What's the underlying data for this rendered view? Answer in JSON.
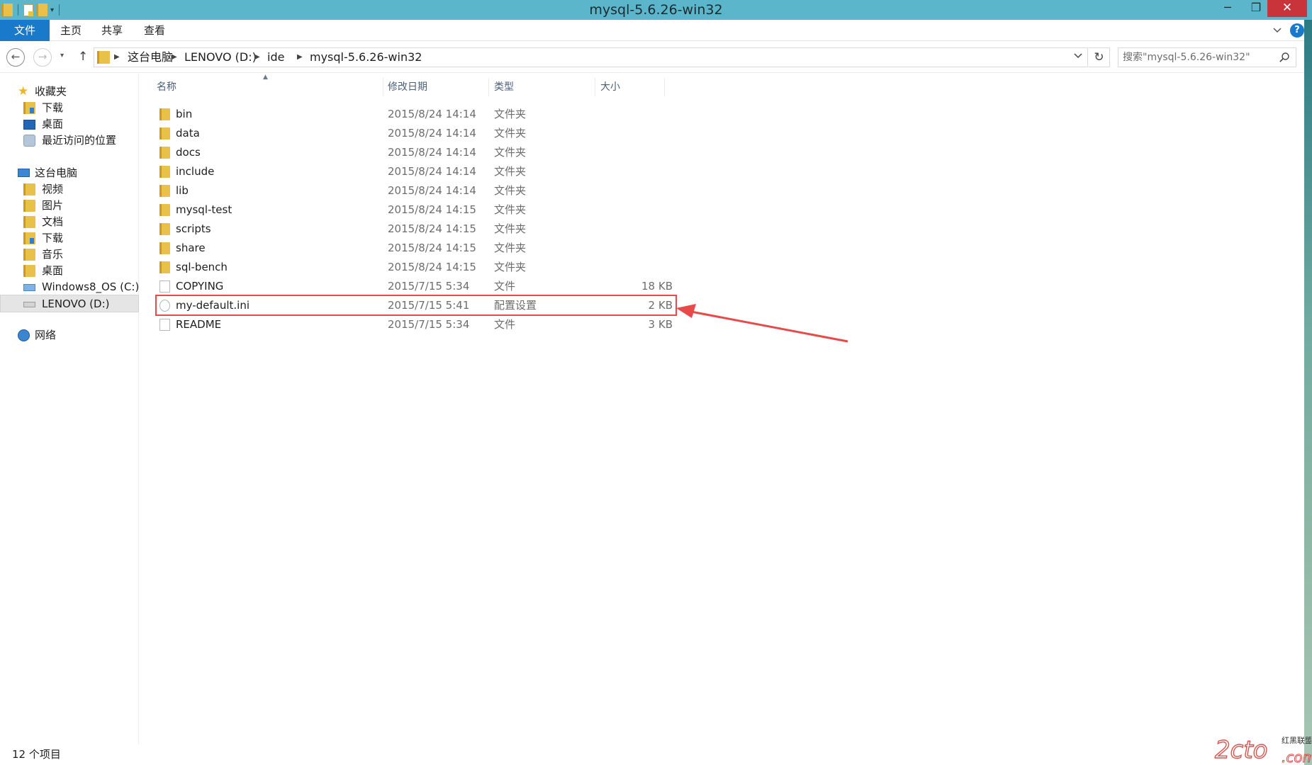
{
  "window": {
    "title": "mysql-5.6.26-win32",
    "minimize_glyph": "─",
    "maximize_glyph": "❐",
    "close_glyph": "✕"
  },
  "ribbon": {
    "tabs": [
      {
        "label": "文件",
        "active": true
      },
      {
        "label": "主页"
      },
      {
        "label": "共享"
      },
      {
        "label": "查看"
      }
    ],
    "help_glyph": "?"
  },
  "address": {
    "back_glyph": "←",
    "forward_glyph": "→",
    "up_glyph": "↑",
    "refresh_glyph": "↻",
    "breadcrumbs": [
      "这台电脑",
      "LENOVO (D:)",
      "ide",
      "mysql-5.6.26-win32"
    ]
  },
  "search": {
    "placeholder": "搜索\"mysql-5.6.26-win32\""
  },
  "sidebar": {
    "items": [
      {
        "label": "收藏夹",
        "icon": "star-icon",
        "indent": 0
      },
      {
        "label": "下载",
        "icon": "downloads-folder-icon",
        "indent": 1
      },
      {
        "label": "桌面",
        "icon": "desktop-icon",
        "indent": 1
      },
      {
        "label": "最近访问的位置",
        "icon": "recent-places-icon",
        "indent": 1
      },
      {
        "label": "这台电脑",
        "icon": "computer-icon",
        "indent": 0
      },
      {
        "label": "视频",
        "icon": "videos-folder-icon",
        "indent": 1
      },
      {
        "label": "图片",
        "icon": "pictures-folder-icon",
        "indent": 1
      },
      {
        "label": "文档",
        "icon": "documents-folder-icon",
        "indent": 1
      },
      {
        "label": "下载",
        "icon": "downloads-folder-icon",
        "indent": 1
      },
      {
        "label": "音乐",
        "icon": "music-folder-icon",
        "indent": 1
      },
      {
        "label": "桌面",
        "icon": "desktop-folder-icon",
        "indent": 1
      },
      {
        "label": "Windows8_OS (C:)",
        "icon": "drive-c-icon",
        "indent": 1
      },
      {
        "label": "LENOVO (D:)",
        "icon": "drive-d-icon",
        "indent": 1,
        "selected": true
      },
      {
        "label": "网络",
        "icon": "network-icon",
        "indent": 0
      }
    ]
  },
  "columns": {
    "name": "名称",
    "date": "修改日期",
    "type": "类型",
    "size": "大小"
  },
  "files": [
    {
      "name": "bin",
      "date": "2015/8/24 14:14",
      "type": "文件夹",
      "size": "",
      "kind": "folder"
    },
    {
      "name": "data",
      "date": "2015/8/24 14:14",
      "type": "文件夹",
      "size": "",
      "kind": "folder"
    },
    {
      "name": "docs",
      "date": "2015/8/24 14:14",
      "type": "文件夹",
      "size": "",
      "kind": "folder"
    },
    {
      "name": "include",
      "date": "2015/8/24 14:14",
      "type": "文件夹",
      "size": "",
      "kind": "folder"
    },
    {
      "name": "lib",
      "date": "2015/8/24 14:14",
      "type": "文件夹",
      "size": "",
      "kind": "folder"
    },
    {
      "name": "mysql-test",
      "date": "2015/8/24 14:15",
      "type": "文件夹",
      "size": "",
      "kind": "folder"
    },
    {
      "name": "scripts",
      "date": "2015/8/24 14:15",
      "type": "文件夹",
      "size": "",
      "kind": "folder"
    },
    {
      "name": "share",
      "date": "2015/8/24 14:15",
      "type": "文件夹",
      "size": "",
      "kind": "folder"
    },
    {
      "name": "sql-bench",
      "date": "2015/8/24 14:15",
      "type": "文件夹",
      "size": "",
      "kind": "folder"
    },
    {
      "name": "COPYING",
      "date": "2015/7/15 5:34",
      "type": "文件",
      "size": "18 KB",
      "kind": "file"
    },
    {
      "name": "my-default.ini",
      "date": "2015/7/15 5:41",
      "type": "配置设置",
      "size": "2 KB",
      "kind": "ini",
      "highlighted": true
    },
    {
      "name": "README",
      "date": "2015/7/15 5:34",
      "type": "文件",
      "size": "3 KB",
      "kind": "file"
    }
  ],
  "status": {
    "count": "12 个项目"
  },
  "colors": {
    "titlebar": "#5cb6cb",
    "file_tab": "#1979ca",
    "close_button": "#c9333a",
    "annotation": "#e84a4a"
  }
}
